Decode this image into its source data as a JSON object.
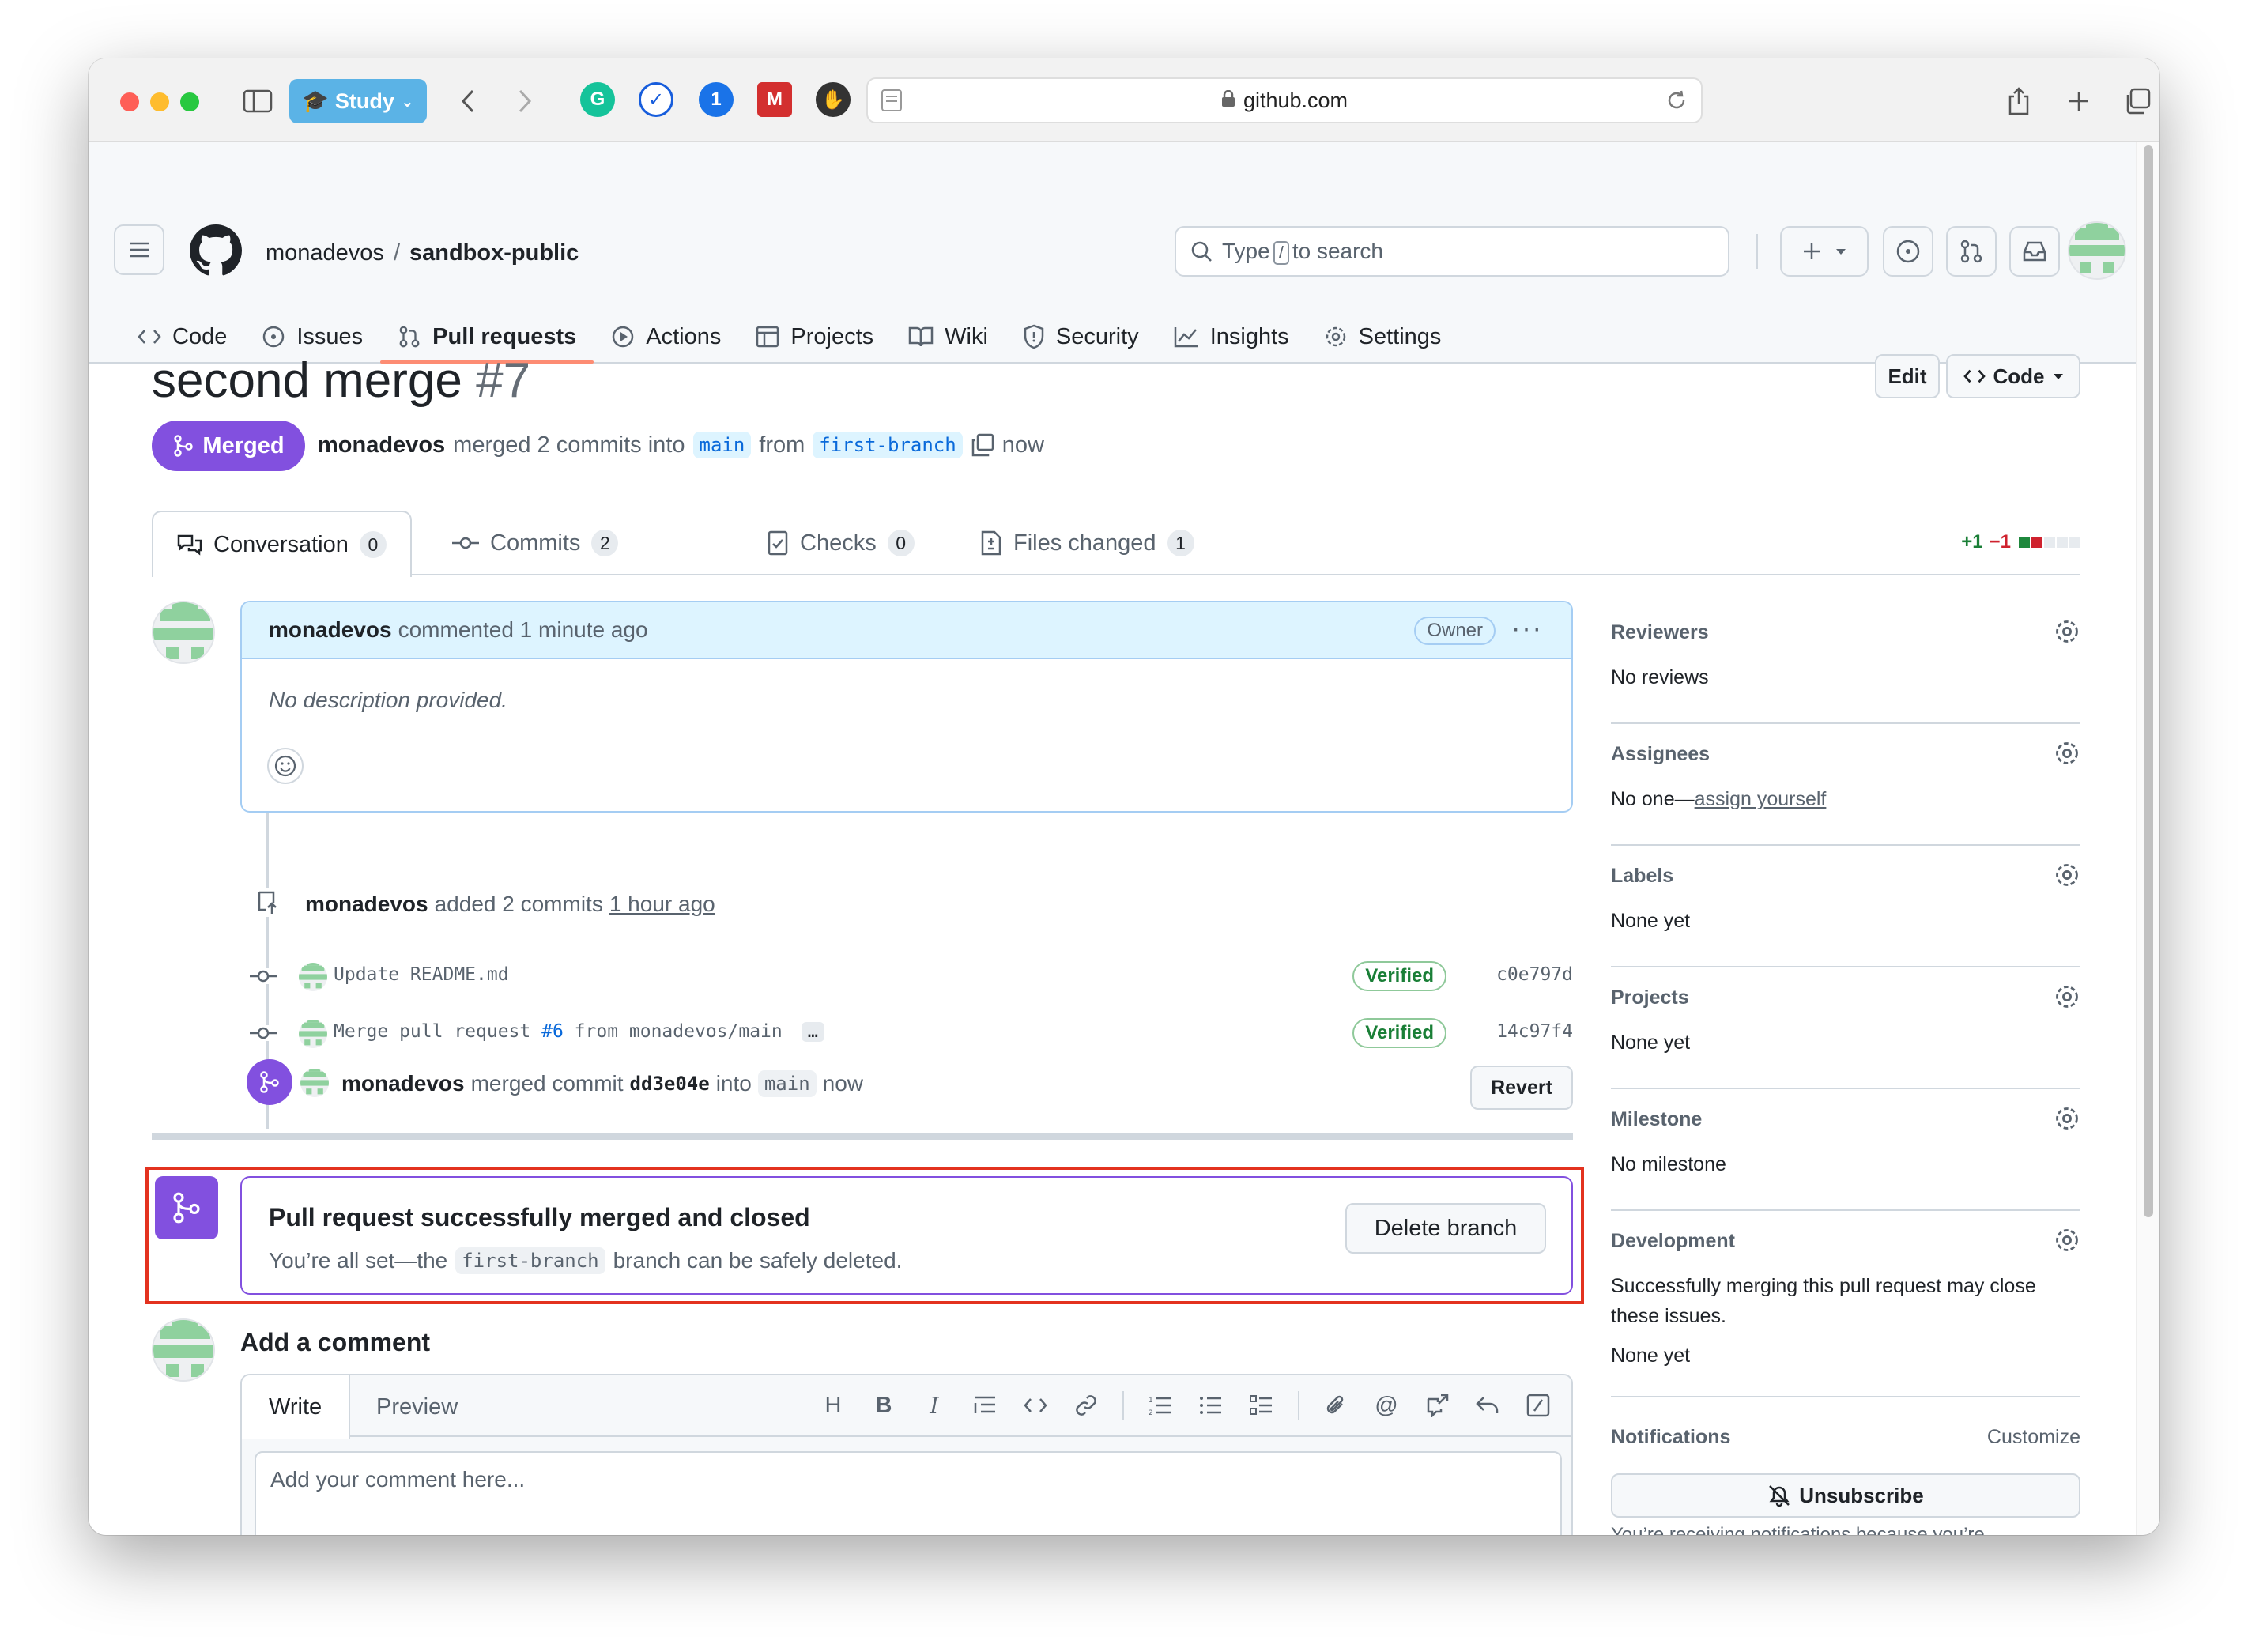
{
  "browser": {
    "study_label": "Study",
    "url": "github.com"
  },
  "repo": {
    "owner": "monadevos",
    "separator": "/",
    "name": "sandbox-public",
    "search_prefix": "Type",
    "search_key": "/",
    "search_suffix": "to search"
  },
  "nav": {
    "items": [
      {
        "label": "Code",
        "icon": "code-icon"
      },
      {
        "label": "Issues",
        "icon": "issue-icon"
      },
      {
        "label": "Pull requests",
        "icon": "pull-request-icon"
      },
      {
        "label": "Actions",
        "icon": "play-icon"
      },
      {
        "label": "Projects",
        "icon": "table-icon"
      },
      {
        "label": "Wiki",
        "icon": "book-icon"
      },
      {
        "label": "Security",
        "icon": "shield-icon"
      },
      {
        "label": "Insights",
        "icon": "graph-icon"
      },
      {
        "label": "Settings",
        "icon": "gear-icon"
      }
    ]
  },
  "pr": {
    "title": "second merge",
    "number": "#7",
    "edit_label": "Edit",
    "code_label": "Code",
    "state": "Merged",
    "author": "monadevos",
    "merged_text": "merged 2 commits into",
    "base": "main",
    "from_text": "from",
    "head": "first-branch",
    "time": "now"
  },
  "tabs": [
    {
      "label": "Conversation",
      "count": "0"
    },
    {
      "label": "Commits",
      "count": "2"
    },
    {
      "label": "Checks",
      "count": "0"
    },
    {
      "label": "Files changed",
      "count": "1"
    }
  ],
  "diffstat": {
    "add": "+1",
    "del": "−1"
  },
  "comment": {
    "author": "monadevos",
    "action": "commented 1 minute ago",
    "badge": "Owner",
    "body": "No description provided."
  },
  "commits_event": {
    "author": "monadevos",
    "action": "added 2 commits",
    "time": "1 hour ago",
    "items": [
      {
        "msg": "Update README.md",
        "verified": "Verified",
        "sha": "c0e797d"
      },
      {
        "msg_pre": "Merge pull request ",
        "msg_link": "#6",
        "msg_post": " from monadevos/main",
        "more": "…",
        "verified": "Verified",
        "sha": "14c97f4"
      }
    ]
  },
  "merge_event": {
    "author": "monadevos",
    "action": "merged commit",
    "sha": "dd3e04e",
    "into": "into",
    "base": "main",
    "time": "now",
    "revert_label": "Revert"
  },
  "merged_box": {
    "title": "Pull request successfully merged and closed",
    "sub_pre": "You’re all set—the",
    "branch": "first-branch",
    "sub_post": "branch can be safely deleted.",
    "delete_label": "Delete branch"
  },
  "add_comment": {
    "heading": "Add a comment",
    "write_tab": "Write",
    "preview_tab": "Preview",
    "placeholder": "Add your comment here...",
    "heading_tool": "H",
    "bold_tool": "B",
    "italic_tool": "I"
  },
  "sidebar": {
    "reviewers": {
      "label": "Reviewers",
      "value": "No reviews"
    },
    "assignees": {
      "label": "Assignees",
      "value": "No one—",
      "link": "assign yourself"
    },
    "labels": {
      "label": "Labels",
      "value": "None yet"
    },
    "projects": {
      "label": "Projects",
      "value": "None yet"
    },
    "milestone": {
      "label": "Milestone",
      "value": "No milestone"
    },
    "development": {
      "label": "Development",
      "value": "Successfully merging this pull request may close these issues.",
      "value2": "None yet"
    },
    "notifications": {
      "label": "Notifications",
      "customize": "Customize",
      "unsubscribe": "Unsubscribe",
      "footer": "You’re receiving notifications because you’re"
    }
  },
  "colors": {
    "merged_purple": "#8250df",
    "accent_blue": "#0969da",
    "verified_green": "#1a7f37",
    "highlight_red": "#e3321f"
  }
}
